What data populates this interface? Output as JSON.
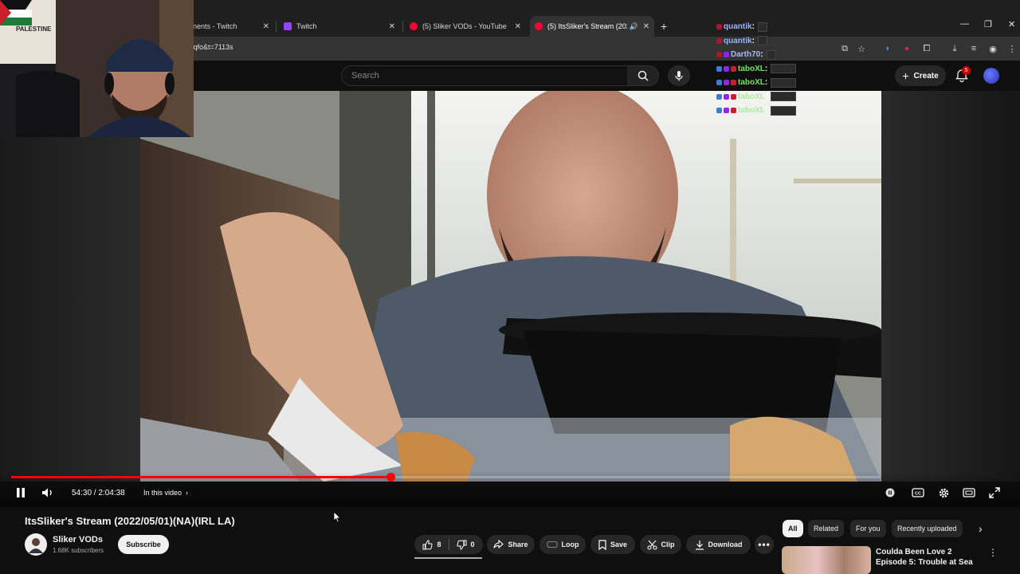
{
  "browser": {
    "tabs": [
      {
        "title": "nents - Twitch",
        "icon": "twitch-icon"
      },
      {
        "title": "Twitch",
        "icon": "twitch-icon"
      },
      {
        "title": "(5) Sliker VODs - YouTube",
        "icon": "youtube-icon"
      },
      {
        "title": "(5) ItsSliker's Stream (2022/",
        "icon": "youtube-icon",
        "active": true
      }
    ],
    "url": "Nqfo&t=7113s"
  },
  "youtube": {
    "search_placeholder": "Search",
    "create_label": "Create",
    "notification_count": "5"
  },
  "player": {
    "time": "54:30 / 2:04:38",
    "in_this_video": "In this video",
    "progress": 0.437,
    "progress_color": "#ff0000"
  },
  "chat": [
    {
      "user": "quantik",
      "color": "#9bb3ff"
    },
    {
      "user": "quantik",
      "color": "#9bb3ff"
    },
    {
      "user": "Darth70",
      "color": "#a9b8ff"
    },
    {
      "user": "taboXL",
      "color": "#6fe85a"
    },
    {
      "user": "taboXL",
      "color": "#6fe85a"
    },
    {
      "user": "taboXL",
      "color": "#6fe85a"
    },
    {
      "user": "taboXL",
      "color": "#6fe85a"
    }
  ],
  "video": {
    "title": "ItsSliker's Stream (2022/05/01)(NA)(IRL LA)",
    "channel": "Sliker VODs",
    "subscribers": "1.68K subscribers",
    "subscribe_label": "Subscribe"
  },
  "actions": {
    "likes": "8",
    "dislikes": "0",
    "share": "Share",
    "loop": "Loop",
    "save": "Save",
    "clip": "Clip",
    "download": "Download"
  },
  "sidebar": {
    "chips": [
      "All",
      "Related",
      "For you",
      "Recently uploaded"
    ],
    "recommendation_title": "Coulda Been Love 2 Episode 5: Trouble at Sea"
  },
  "webcam": {
    "poster_text": "PALESTINE"
  }
}
